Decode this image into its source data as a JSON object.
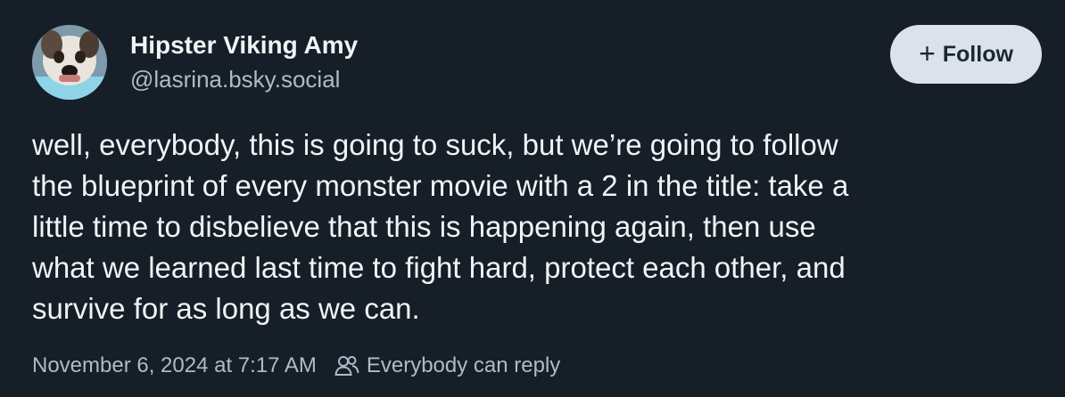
{
  "author": {
    "display_name": "Hipster Viking Amy",
    "handle": "@lasrina.bsky.social",
    "avatar_icon": "dog-avatar"
  },
  "follow_button": {
    "icon": "plus-icon",
    "icon_glyph": "+",
    "label": "Follow"
  },
  "post": {
    "lines": [
      "well, everybody, this is going to suck, but we’re going to follow",
      "the blueprint of every monster movie with a 2 in the title: take a",
      "little time to disbelieve that this is happening again, then use",
      "what we learned last time to fight hard, protect each other, and",
      "survive for as long as we can."
    ],
    "timestamp": "November 6, 2024 at 7:17 AM",
    "reply_setting": "Everybody can reply",
    "reply_icon": "people-icon"
  },
  "colors": {
    "background": "#161e27",
    "text": "#f1f3f5",
    "muted": "#aebbc9",
    "button_bg": "#dce2ea",
    "button_text": "#1a2734"
  }
}
